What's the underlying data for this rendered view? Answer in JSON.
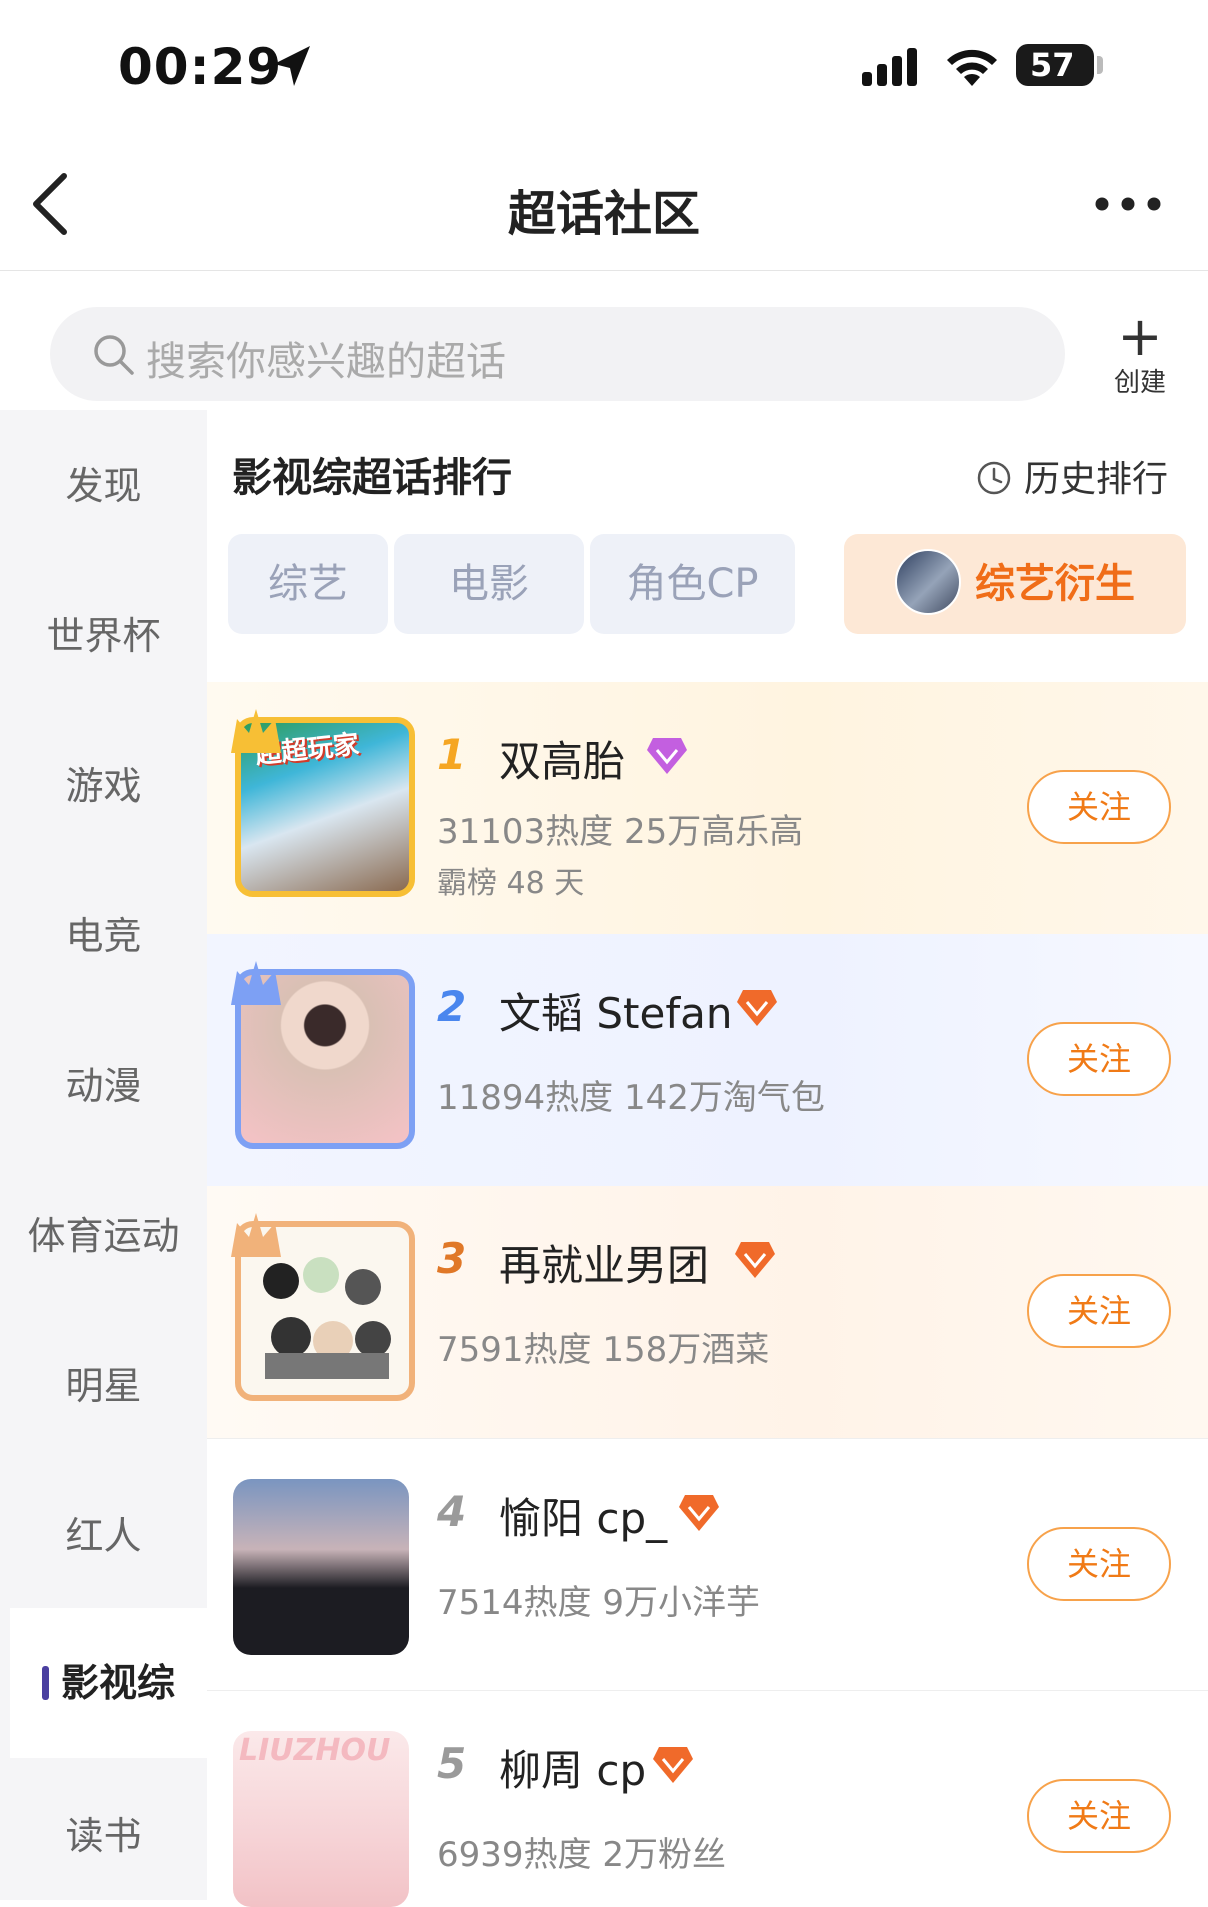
{
  "status_bar": {
    "time": "00:29",
    "battery": "57"
  },
  "nav": {
    "title": "超话社区"
  },
  "search": {
    "placeholder": "搜索你感兴趣的超话",
    "create_label": "创建"
  },
  "sidebar": {
    "items": [
      {
        "label": "发现"
      },
      {
        "label": "世界杯"
      },
      {
        "label": "游戏"
      },
      {
        "label": "电竞"
      },
      {
        "label": "动漫"
      },
      {
        "label": "体育运动"
      },
      {
        "label": "明星"
      },
      {
        "label": "红人"
      },
      {
        "label": "影视综",
        "active": true
      },
      {
        "label": "读书"
      }
    ]
  },
  "main": {
    "header": "影视综超话排行",
    "history_label": "历史排行",
    "tabs": [
      {
        "label": "综艺"
      },
      {
        "label": "电影"
      },
      {
        "label": "角色CP"
      },
      {
        "label": "综艺衍生",
        "active": true
      }
    ],
    "follow_label": "关注",
    "rankings": [
      {
        "rank": "1",
        "name": "双高胎",
        "stats": "31103热度 25万高乐高",
        "sub": "霸榜 48 天",
        "cover_text": "超超玩家",
        "gem": "purple"
      },
      {
        "rank": "2",
        "name": "文韬 Stefan",
        "stats": "11894热度 142万淘气包",
        "gem": "orange"
      },
      {
        "rank": "3",
        "name": "再就业男团",
        "stats": "7591热度 158万酒菜",
        "gem": "orange"
      },
      {
        "rank": "4",
        "name": "愉阳 cp_",
        "stats": "7514热度 9万小洋芋",
        "gem": "orange"
      },
      {
        "rank": "5",
        "name": "柳周 cp",
        "stats": "6939热度 2万粉丝",
        "cover_text": "LIUZHOU",
        "gem": "orange"
      }
    ]
  },
  "colors": {
    "accent_orange": "#f07a16",
    "rank1": "#f5a623",
    "rank2": "#4a86ee",
    "rank3": "#e07828",
    "rank_gray": "#9a9a9a",
    "sidebar_active": "#4a3fa0"
  }
}
